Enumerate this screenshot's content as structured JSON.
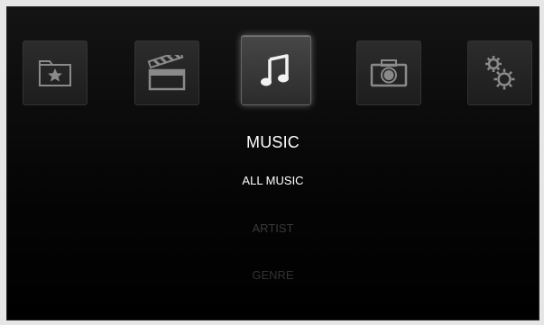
{
  "icons": [
    {
      "name": "favorites-folder-icon",
      "selected": false
    },
    {
      "name": "video-clapperboard-icon",
      "selected": false
    },
    {
      "name": "music-note-icon",
      "selected": true
    },
    {
      "name": "camera-icon",
      "selected": false
    },
    {
      "name": "settings-gears-icon",
      "selected": false
    }
  ],
  "section": {
    "title": "MUSIC"
  },
  "menu": {
    "items": [
      {
        "label": "ALL MUSIC",
        "state": "active"
      },
      {
        "label": "ARTIST",
        "state": "inactive"
      },
      {
        "label": "GENRE",
        "state": "inactive"
      }
    ]
  },
  "colors": {
    "background": "#000000",
    "tile": "#262626",
    "active_text": "#ffffff",
    "inactive_text": "#3a3a3a"
  }
}
